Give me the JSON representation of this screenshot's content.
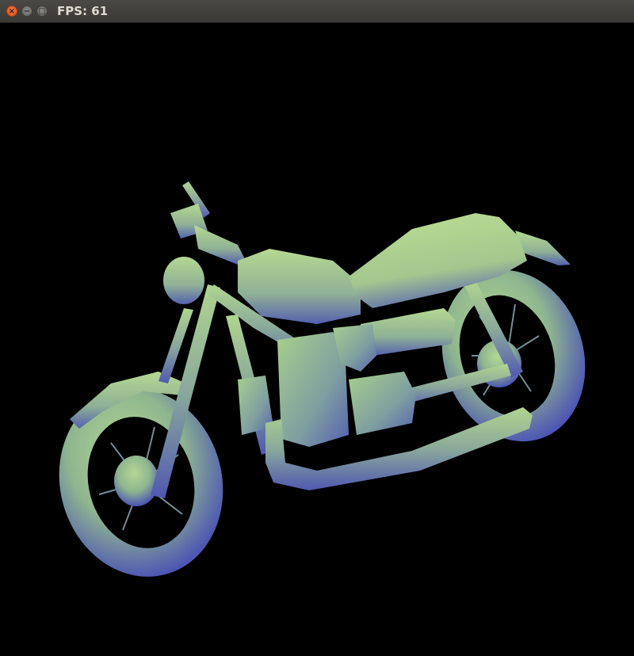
{
  "window": {
    "title": "FPS: 61",
    "close_glyph": "×",
    "minimize_glyph": "−",
    "maximize_glyph": "□"
  },
  "scene": {
    "background_color": "#000000",
    "model_light_color": "#a6d38a",
    "model_shadow_color": "#5055b0",
    "model_subject": "motorcycle"
  }
}
